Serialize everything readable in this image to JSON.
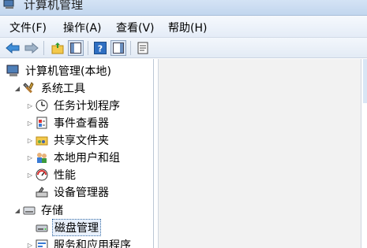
{
  "window": {
    "title": "计算机管理"
  },
  "menu": {
    "file": "文件(F)",
    "action": "操作(A)",
    "view": "查看(V)",
    "help": "帮助(H)"
  },
  "toolbar": {
    "icons": [
      "back-arrow-icon",
      "forward-arrow-icon",
      "up-folder-icon",
      "show-tree-icon",
      "help-icon",
      "show-action-pane-icon",
      "properties-icon"
    ]
  },
  "tree": {
    "root": "计算机管理(本地)",
    "system_tools": "系统工具",
    "task_scheduler": "任务计划程序",
    "event_viewer": "事件查看器",
    "shared_folders": "共享文件夹",
    "local_users": "本地用户和组",
    "performance": "性能",
    "device_manager": "设备管理器",
    "storage": "存储",
    "disk_management": "磁盘管理",
    "services": "服务和应用程序"
  },
  "colors": {
    "titlebar": "#c8dbf1",
    "selection_border": "#3a6ea5",
    "content_bg": "#f2f2f2"
  }
}
